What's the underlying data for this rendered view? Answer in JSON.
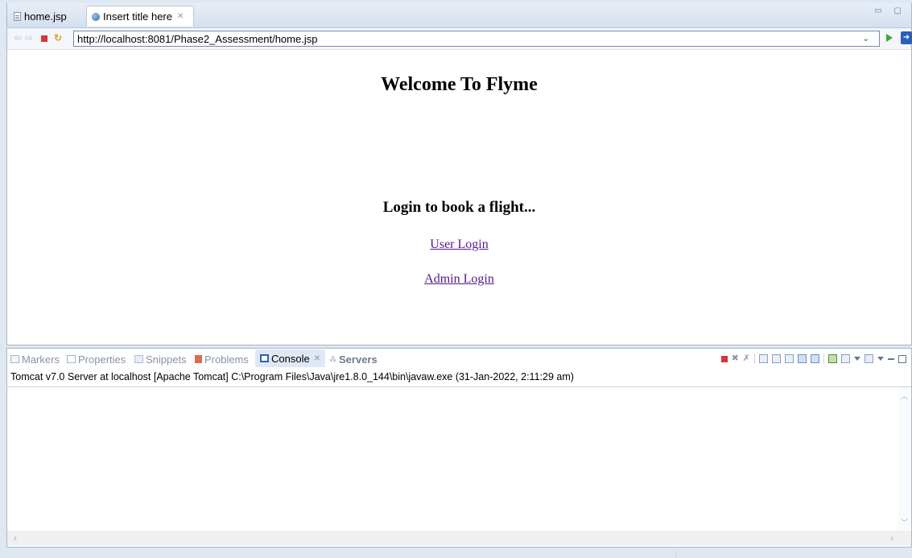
{
  "editor": {
    "tabs": [
      {
        "label": "home.jsp",
        "icon": "jsp-file-icon",
        "active": false
      },
      {
        "label": "Insert title here",
        "icon": "browser-globe-icon",
        "active": true,
        "close": "✕"
      }
    ],
    "window_controls": "▭ ▢"
  },
  "browser": {
    "url": "http://localhost:8081/Phase2_Assessment/home.jsp",
    "dropdown_glyph": "⌄"
  },
  "page": {
    "welcome": "Welcome To Flyme",
    "login_heading": "Login to book a flight...",
    "links": {
      "user_login": "User Login",
      "admin_login": "Admin Login"
    },
    "link_color": "#551a8b"
  },
  "views": {
    "tabs": {
      "markers": "Markers",
      "properties": "Properties",
      "snippets": "Snippets",
      "problems": "Problems",
      "console": "Console",
      "servers": "Servers"
    },
    "console_close": "✕",
    "console_label": "Tomcat v7.0 Server at localhost [Apache Tomcat] C:\\Program Files\\Java\\jre1.8.0_144\\bin\\javaw.exe (31-Jan-2022, 2:11:29 am)"
  },
  "colors": {
    "accent": "#2c63b5",
    "terminate": "#d9333c",
    "background": "#dfe7f1"
  }
}
